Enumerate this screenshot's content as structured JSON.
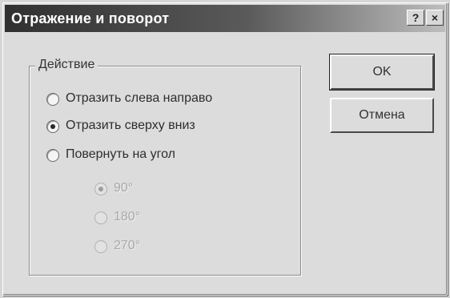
{
  "window": {
    "title": "Отражение и поворот",
    "help_label": "?",
    "close_label": "×"
  },
  "group": {
    "label": "Действие",
    "options": [
      {
        "label": "Отразить слева направо",
        "selected": false
      },
      {
        "label": "Отразить сверху вниз",
        "selected": true
      },
      {
        "label": "Повернуть на угол",
        "selected": false
      }
    ],
    "angles": [
      {
        "label": "90°",
        "selected": true,
        "disabled": true
      },
      {
        "label": "180°",
        "selected": false,
        "disabled": true
      },
      {
        "label": "270°",
        "selected": false,
        "disabled": true
      }
    ]
  },
  "buttons": {
    "ok": "OK",
    "cancel": "Отмена"
  }
}
